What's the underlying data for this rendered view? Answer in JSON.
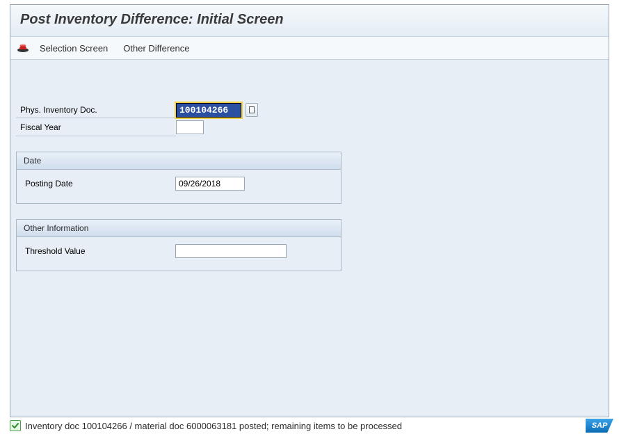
{
  "header": {
    "title": "Post Inventory Difference: Initial Screen"
  },
  "toolbar": {
    "selection_screen": "Selection Screen",
    "other_difference": "Other Difference"
  },
  "fields": {
    "phys_inventory_doc": {
      "label": "Phys. Inventory Doc.",
      "value": "100104266"
    },
    "fiscal_year": {
      "label": "Fiscal Year",
      "value": ""
    }
  },
  "groups": {
    "date": {
      "title": "Date",
      "posting_date": {
        "label": "Posting Date",
        "value": "09/26/2018"
      }
    },
    "other_info": {
      "title": "Other Information",
      "threshold_value": {
        "label": "Threshold Value",
        "value": ""
      }
    }
  },
  "status": {
    "message": "Inventory doc 100104266 / material doc 6000063181 posted; remaining items to be processed"
  },
  "branding": {
    "sap": "SAP"
  }
}
